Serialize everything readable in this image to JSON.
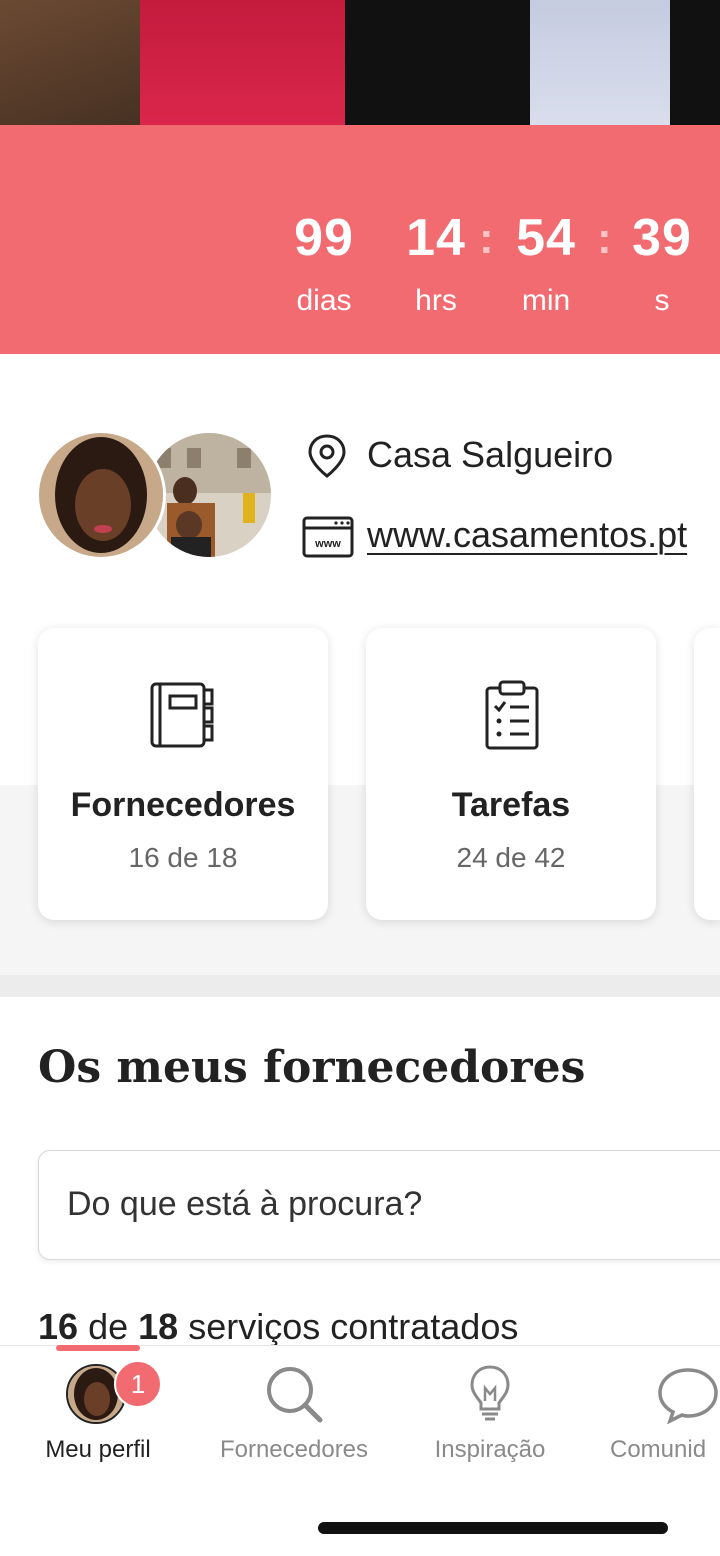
{
  "countdown": {
    "days": "99",
    "days_label": "dias",
    "hours": "14",
    "hours_label": "hrs",
    "minutes": "54",
    "minutes_label": "min",
    "seconds": "39",
    "seconds_label": "s",
    "separator": ":"
  },
  "profile": {
    "venue": "Casa Salgueiro",
    "website": "www.casamentos.pt"
  },
  "cards": [
    {
      "title": "Fornecedores",
      "progress": "16 de 18",
      "icon": "notebook-icon"
    },
    {
      "title": "Tarefas",
      "progress": "24 de 42",
      "icon": "clipboard-checklist-icon"
    }
  ],
  "vendors": {
    "title": "Os meus fornecedores",
    "search_placeholder": "Do que está à procura?",
    "count_hired": "16",
    "count_word_de": "de",
    "count_total": "18",
    "count_suffix": "serviços contratados"
  },
  "nav": {
    "items": [
      {
        "label": "Meu perfil",
        "icon": "avatar",
        "badge": "1",
        "active": true
      },
      {
        "label": "Fornecedores",
        "icon": "search-icon"
      },
      {
        "label": "Inspiração",
        "icon": "lightbulb-icon"
      },
      {
        "label": "Comunid",
        "icon": "chat-bubble-icon"
      }
    ]
  },
  "colors": {
    "accent": "#f26b70",
    "text": "#222222",
    "muted": "#8a8a8a"
  }
}
